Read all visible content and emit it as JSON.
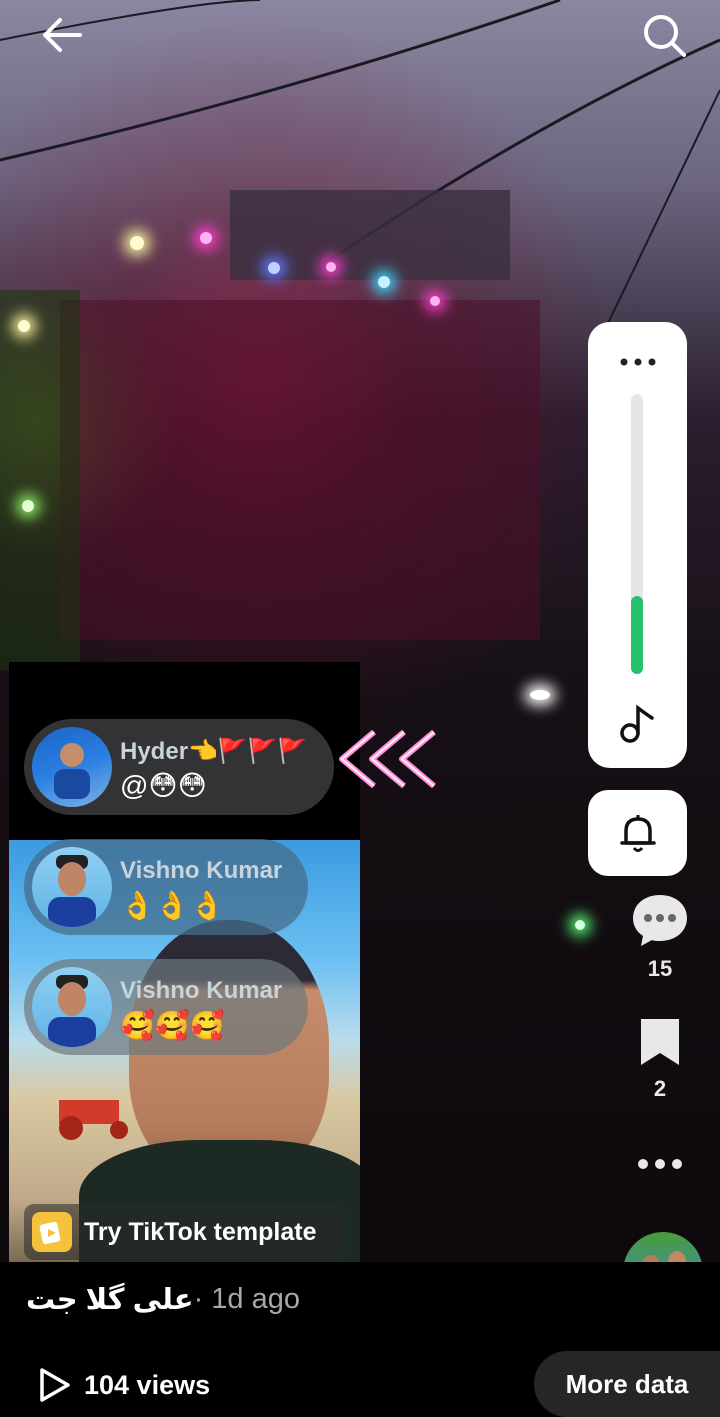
{
  "nav": {
    "back_icon": "arrow-left-icon",
    "search_icon": "search-icon"
  },
  "comments": [
    {
      "name": "Hyder👈🚩🚩🚩",
      "text": "@😳😳"
    },
    {
      "name": "Vishno Kumar",
      "text": "👌👌👌"
    },
    {
      "name": "Vishno Kumar",
      "text": "🥰🥰🥰"
    }
  ],
  "template_button": {
    "label": "Try TikTok template",
    "icon": "tiktok-template-icon"
  },
  "side_panel": {
    "menu_icon": "more-horizontal-icon",
    "music_icon": "music-note-icon",
    "volume_level": 0.28,
    "bell_icon": "bell-icon"
  },
  "actions": {
    "comments_count": "15",
    "saves_count": "2",
    "more_icon": "more-horizontal-icon"
  },
  "post": {
    "author": "علی گلا جت",
    "time": " · 1d ago",
    "views": "104 views",
    "play_icon": "play-icon",
    "more_data_label": "More data"
  },
  "colors": {
    "accent_green": "#25c26b",
    "panel_white": "#ffffff",
    "pill_bg": "#262626"
  }
}
